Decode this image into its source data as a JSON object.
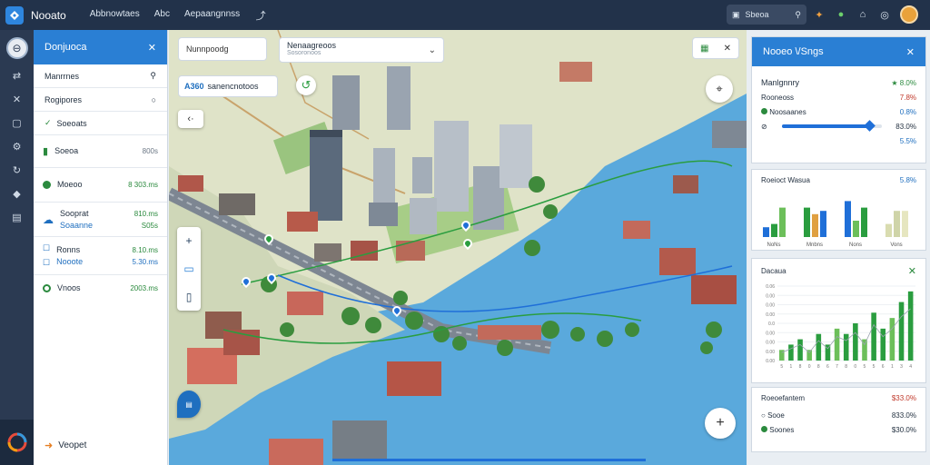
{
  "app": {
    "title": "Nooato"
  },
  "topbar": {
    "menu": [
      "Abbnowtaes",
      "Abc",
      "Aepaangnnss"
    ],
    "search_label": "Sbeoa"
  },
  "left_panel": {
    "title": "Donjuoca",
    "rows": [
      {
        "label": "Manrrnes"
      },
      {
        "label": "Rogipores"
      },
      {
        "label": "Soeoats"
      }
    ],
    "items": [
      {
        "name": "Soeoa",
        "value": "800s"
      },
      {
        "name": "Moeoo",
        "value": "8 303.ms"
      },
      {
        "name": "Sooprat",
        "subname": "Soaanne",
        "value": "810.ms",
        "subvalue": "S05s"
      },
      {
        "name": "Ronns",
        "subname": "Nooote",
        "value": "8.10.ms",
        "subvalue": "5.30.ms"
      },
      {
        "name": "Vnoos",
        "value": "2003.ms"
      }
    ],
    "footer": "Veopet"
  },
  "map": {
    "search_text": "Nunnpoodg",
    "dropdown_title": "Nenaagreoos",
    "dropdown_sub": "Sosoronoos",
    "chip_num": "A360",
    "chip_text": "sanencnotoos"
  },
  "right_panel_1": {
    "title": "Nooeo \\/Sngs",
    "rows": [
      {
        "label": "Manlgnnry",
        "value": "★ 8.0%",
        "color": "#2b8a3e"
      },
      {
        "label": "Rooneoss",
        "value": "7.8%",
        "color": "#c0392b"
      },
      {
        "label": "Noosaanes",
        "value": "0.8%",
        "color": "#1f6fbf"
      },
      {
        "label": "",
        "value": "83.0%",
        "color": "#1f2d3d"
      },
      {
        "label": "",
        "value": "5.5%",
        "color": "#1f6fbf"
      }
    ],
    "slider_level": 0.88
  },
  "right_panel_2": {
    "title": "Roeioct Wasua",
    "value": "5.8%",
    "labels": [
      "NoNs",
      "Mnbns",
      "Nons",
      "Vons"
    ],
    "bars": [
      {
        "a": 3,
        "b": 4,
        "c": 9
      },
      {
        "a": 9,
        "b": 7,
        "c": 8
      },
      {
        "a": 11,
        "b": 5,
        "c": 9
      },
      {
        "a": 4,
        "b": 8,
        "c": 8
      }
    ]
  },
  "right_panel_3": {
    "title": "Dacaua",
    "y_ticks": [
      "0.06",
      "0.00",
      "0.00",
      "0.00",
      "0.0",
      "0.00",
      "0.00",
      "0.00",
      "0.00"
    ],
    "x_ticks": [
      "5",
      "1",
      "8",
      "0",
      "8",
      "6",
      "7",
      "8",
      "0",
      "5",
      "5",
      "6",
      "1",
      "3",
      "4"
    ],
    "bars": [
      2,
      3,
      4,
      2,
      5,
      3,
      6,
      5,
      7,
      4,
      9,
      6,
      8,
      11,
      13
    ]
  },
  "right_panel_4": {
    "title": "Roeoefantem",
    "value": "$33.0%",
    "rows": [
      {
        "label": "Sooe",
        "value": "833.0%"
      },
      {
        "label": "Soones",
        "value": "$30.0%"
      }
    ]
  },
  "colors": {
    "accent": "#2a7fd4",
    "topbar": "#22324a",
    "water": "#5aa9dc"
  }
}
